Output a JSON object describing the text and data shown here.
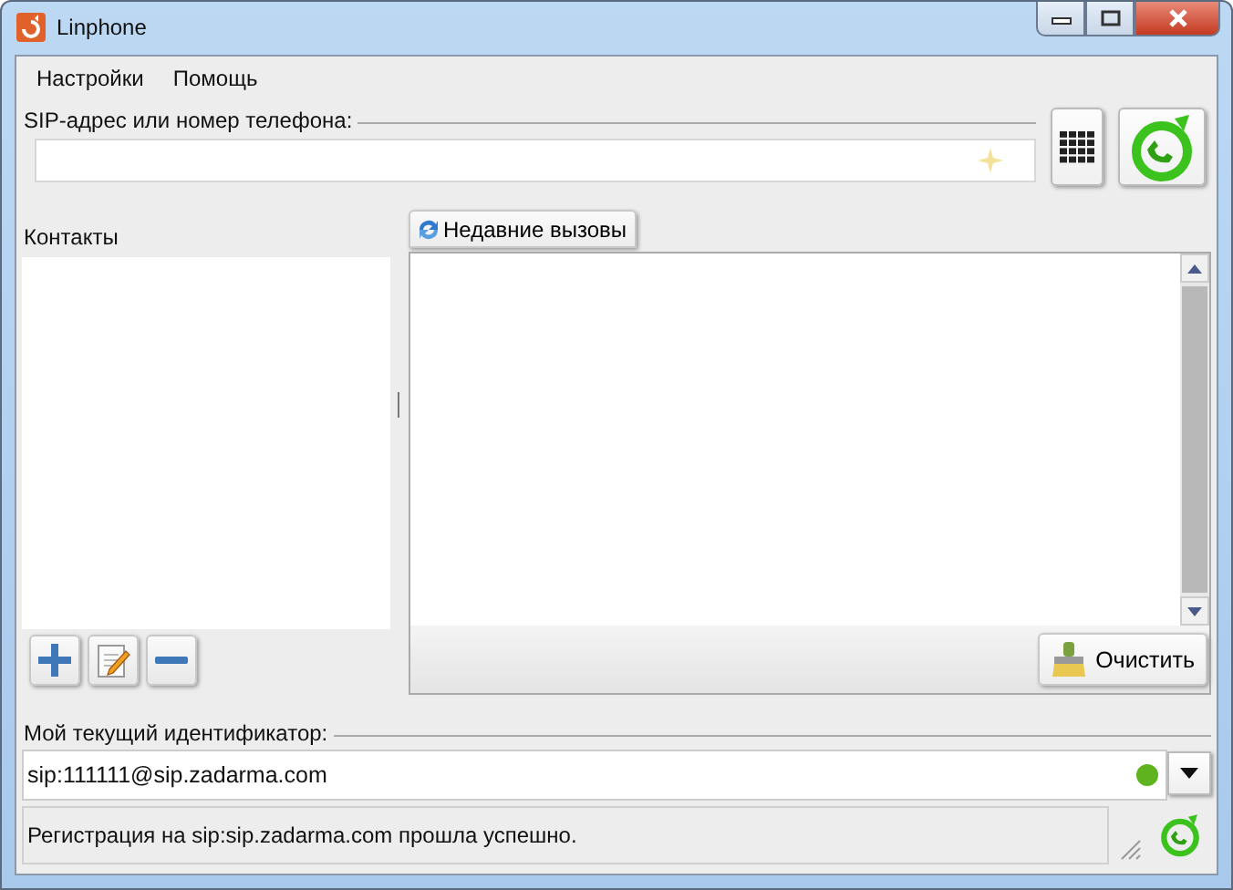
{
  "window": {
    "title": "Linphone"
  },
  "menu": [
    "Настройки",
    "Помощь"
  ],
  "sip": {
    "label": "SIP-адрес или номер телефона:"
  },
  "contacts": {
    "title": "Контакты"
  },
  "recent": {
    "tab": "Недавние вызовы",
    "clear_button": "Очистить"
  },
  "identity": {
    "label": "Мой текущий идентификатор:",
    "value": "sip:111111@sip.zadarma.com",
    "status_dot": {
      "color": "#5fb31f"
    }
  },
  "status_bar": "Регистрация на sip:sip.zadarma.com прошла успешно."
}
